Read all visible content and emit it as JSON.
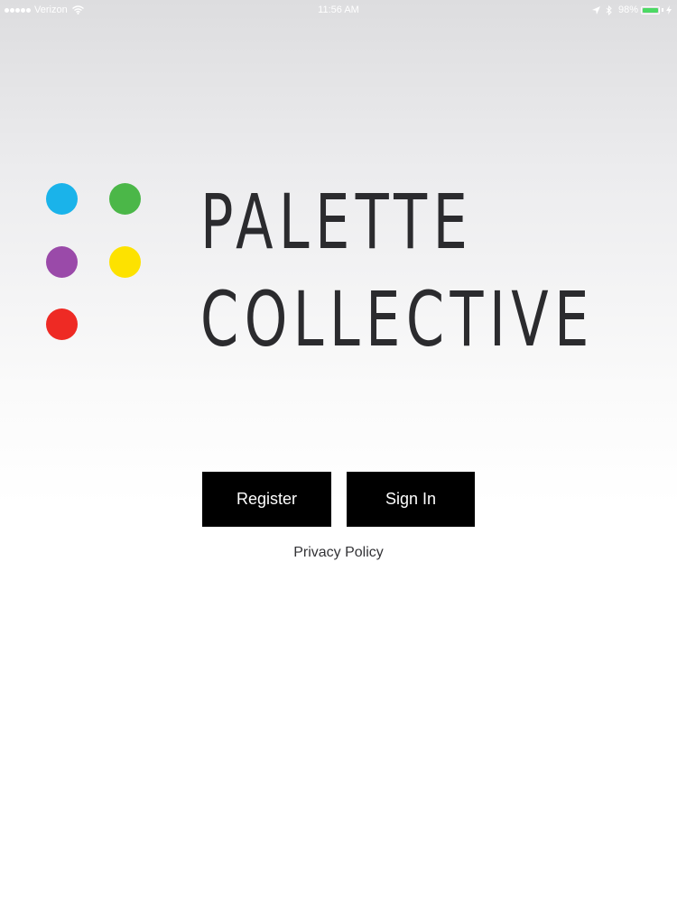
{
  "status_bar": {
    "carrier": "Verizon",
    "time": "11:56 AM",
    "battery_percent": "98%",
    "battery_level": 0.98,
    "battery_color": "#4cd964",
    "icons": [
      "signal-icon",
      "wifi-icon",
      "location-icon",
      "bluetooth-icon",
      "battery-icon",
      "charging-icon"
    ]
  },
  "logo": {
    "line1": "PALETTE",
    "line2": "COLLECTIVE",
    "dot_colors": [
      "#1ab3ea",
      "#4bb748",
      "#9a4aa9",
      "#fde200",
      "#ee2a24"
    ]
  },
  "actions": {
    "register_label": "Register",
    "signin_label": "Sign In",
    "privacy_label": "Privacy Policy"
  }
}
